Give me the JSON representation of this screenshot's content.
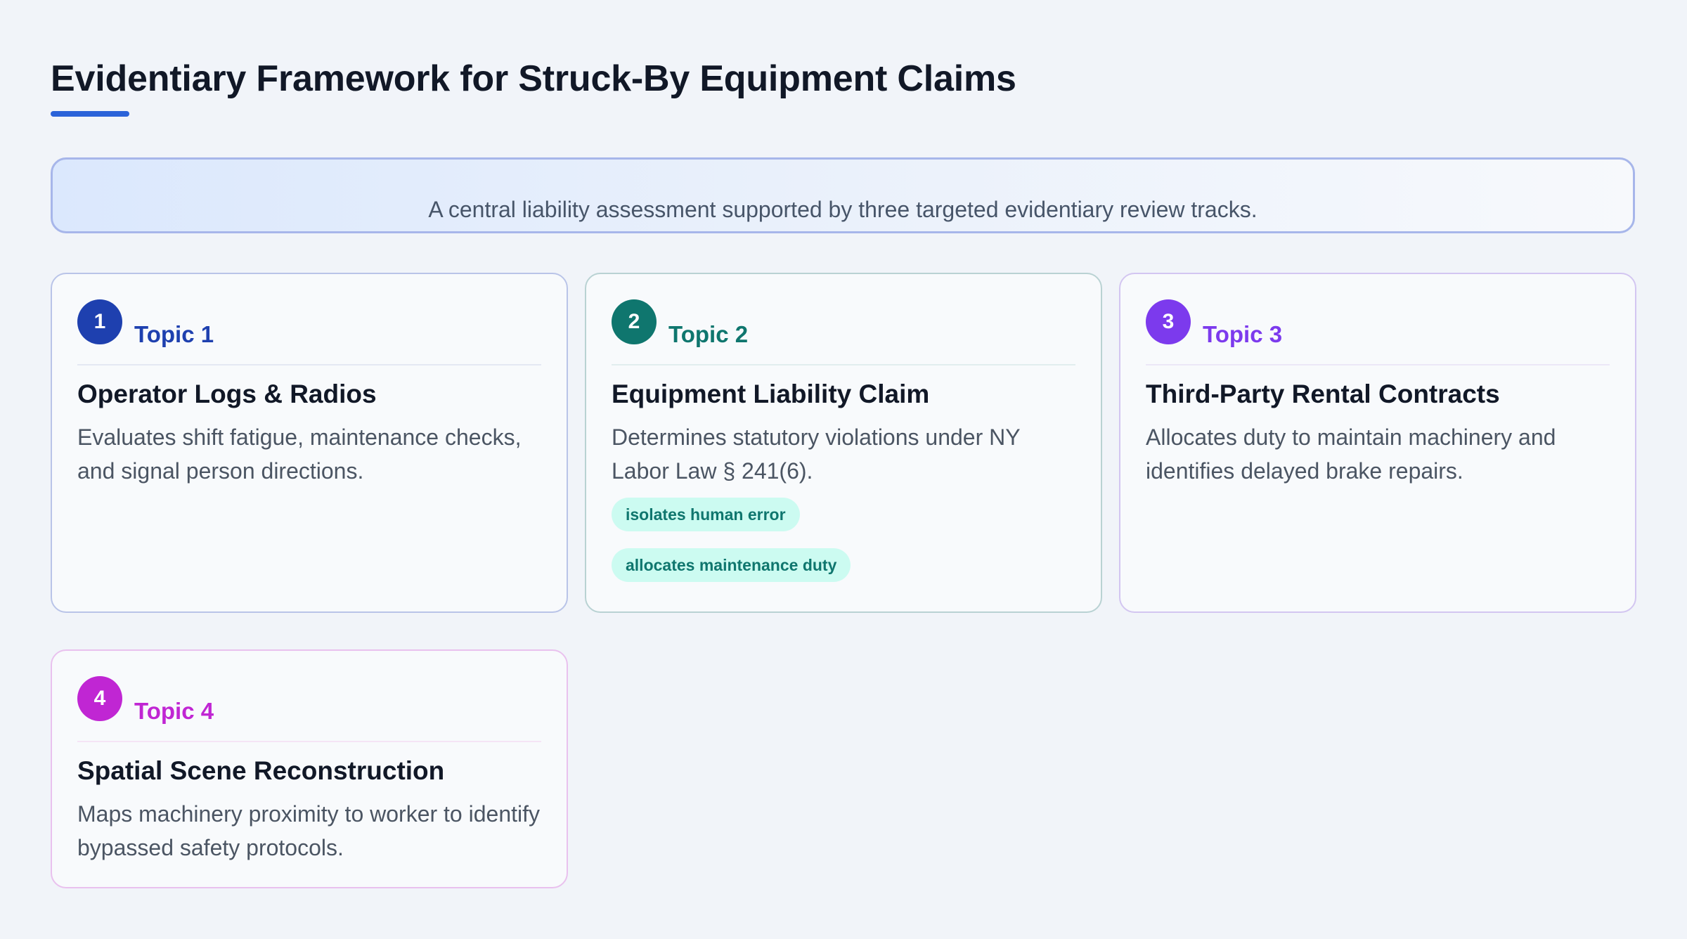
{
  "header": {
    "title": "Evidentiary Framework for Struck-By Equipment Claims",
    "underline_color": "#2b63d9"
  },
  "banner": {
    "text": "A central liability assessment supported by three targeted evidentiary review tracks."
  },
  "cards": [
    {
      "number": "1",
      "topic": "Topic 1",
      "title": "Operator Logs & Radios",
      "description": "Evaluates shift fatigue, maintenance checks, and signal person directions.",
      "accent_color": "#1e40af",
      "border_color": "#b9c4e8",
      "divider_color": "#e4e8f3",
      "tags": []
    },
    {
      "number": "2",
      "topic": "Topic 2",
      "title": "Equipment Liability Claim",
      "description": "Determines statutory violations under NY Labor Law § 241(6).",
      "accent_color": "#0f766e",
      "border_color": "#b9d2d3",
      "divider_color": "#e1eeee",
      "tags": [
        "isolates human error",
        "allocates maintenance duty"
      ],
      "tag_bg": "#ccfbf1",
      "tag_text": "#0f766e"
    },
    {
      "number": "3",
      "topic": "Topic 3",
      "title": "Third-Party Rental Contracts",
      "description": "Allocates duty to maintain machinery and identifies delayed brake repairs.",
      "accent_color": "#7c3aed",
      "border_color": "#d3c6f1",
      "divider_color": "#ece7f7",
      "tags": []
    },
    {
      "number": "4",
      "topic": "Topic 4",
      "title": "Spatial Scene Reconstruction",
      "description": "Maps machinery proximity to worker to identify bypassed safety protocols.",
      "accent_color": "#c026d3",
      "border_color": "#e9c1ee",
      "divider_color": "#f5e4f5",
      "tags": []
    }
  ]
}
